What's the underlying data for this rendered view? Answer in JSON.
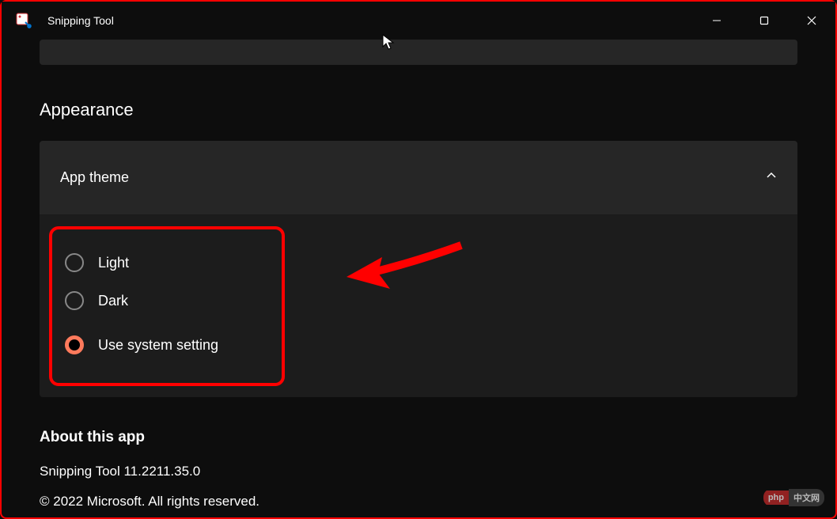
{
  "window": {
    "title": "Snipping Tool"
  },
  "appearance": {
    "heading": "Appearance",
    "expander": {
      "title": "App theme",
      "options": {
        "light": "Light",
        "dark": "Dark",
        "system": "Use system setting"
      },
      "selected": "system"
    }
  },
  "about": {
    "heading": "About this app",
    "version": "Snipping Tool 11.2211.35.0",
    "copyright": "© 2022 Microsoft. All rights reserved."
  },
  "watermark": {
    "left": "php",
    "right": "中文网"
  }
}
